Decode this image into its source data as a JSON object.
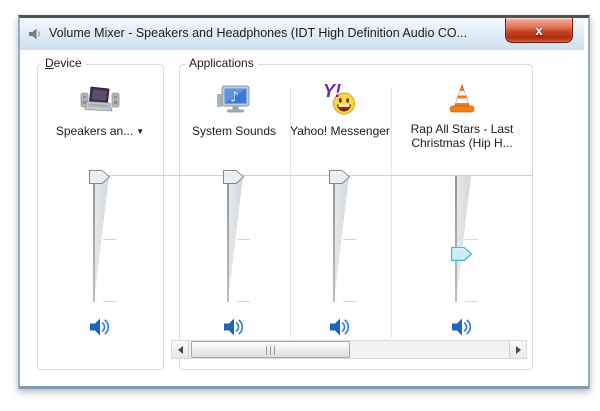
{
  "window": {
    "title": "Volume Mixer - Speakers and Headphones (IDT High Definition Audio CO...",
    "close_glyph": "x"
  },
  "device_group": {
    "label_mnemonic": "D",
    "label_rest": "evice",
    "device_selector": {
      "label": "Speakers an...",
      "arrow": "▼"
    },
    "volume_percent": 100,
    "muted": false
  },
  "applications_group": {
    "label": "Applications",
    "apps": [
      {
        "name": "System Sounds",
        "volume_percent": 100,
        "muted": false,
        "thumb_highlighted": false
      },
      {
        "name": "Yahoo! Messenger",
        "volume_percent": 100,
        "muted": false,
        "thumb_highlighted": false
      },
      {
        "name": "Rap All Stars - Last Christmas (Hip H...",
        "volume_percent": 38,
        "muted": false,
        "thumb_highlighted": true
      }
    ]
  },
  "scrollbar": {
    "orientation": "horizontal",
    "thumb_position": "left",
    "thumb_fraction": 0.47
  },
  "icons": {
    "window_icon": "speaker-icon",
    "device_icon": "laptop-with-speakers-icon",
    "app_icons": [
      "system-sounds-monitor-note-icon",
      "yahoo-messenger-smiley-icon",
      "vlc-cone-icon"
    ],
    "mute_button_icon": "speaker-volume-icon",
    "selector_arrow_icon": "chevron-down-icon",
    "scrollbar_icons": [
      "scroll-left-arrow-icon",
      "scroll-right-arrow-icon",
      "scrollbar-grip-icon"
    ]
  },
  "colors": {
    "close_button_red": "#c43c22",
    "titlebar_blue": "#dfeaf6",
    "slider_thumb_highlight_cyan": "#45b7d3",
    "mute_speaker_blue": "#2164bd",
    "yahoo_purple": "#6a28ab",
    "smiley_yellow": "#ffd83a",
    "vlc_orange": "#f07f1e",
    "system_sounds_blue": "#3b79d6"
  }
}
